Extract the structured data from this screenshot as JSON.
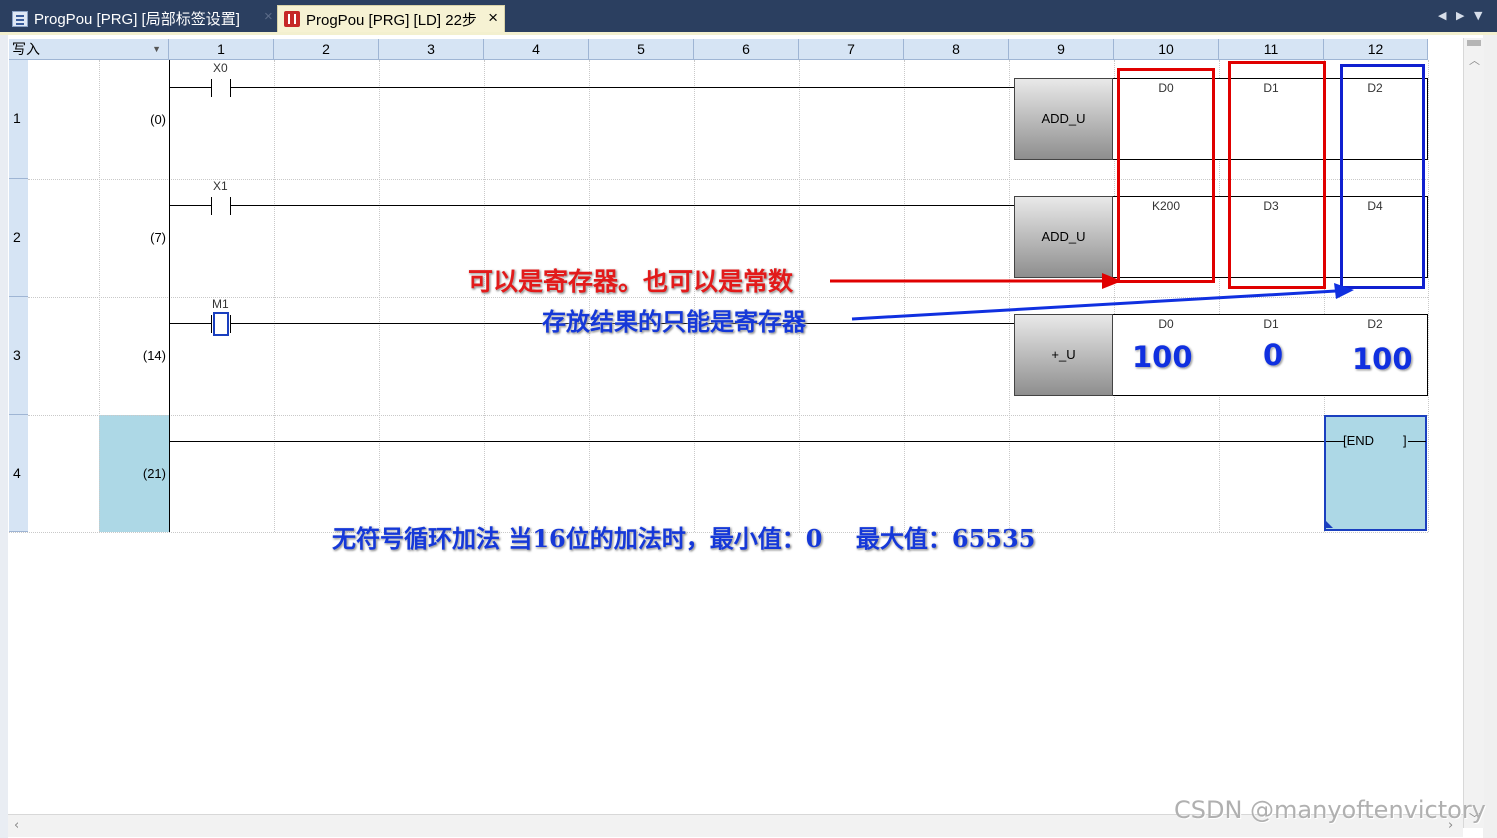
{
  "tabs": [
    {
      "label": "ProgPou [PRG] [局部标签设置]",
      "active": false
    },
    {
      "label": "ProgPou [PRG] [LD] 22步",
      "active": true
    }
  ],
  "tab_icons": {
    "inactive": "program-icon",
    "active": "ladder-icon",
    "close": "×"
  },
  "tab_nav": {
    "prev": "◀",
    "next": "▶",
    "menu": "▼"
  },
  "mode": "写入",
  "columns": [
    "1",
    "2",
    "3",
    "4",
    "5",
    "6",
    "7",
    "8",
    "9",
    "10",
    "11",
    "12"
  ],
  "rows": [
    {
      "num": "1",
      "step": "(0)",
      "contact": "X0",
      "instruction": "ADD_U",
      "operands": [
        "D0",
        "D1",
        "D2"
      ]
    },
    {
      "num": "2",
      "step": "(7)",
      "contact": "X1",
      "instruction": "ADD_U",
      "operands": [
        "K200",
        "D3",
        "D4"
      ]
    },
    {
      "num": "3",
      "step": "(14)",
      "contact": "M1",
      "instruction": "+_U",
      "operands": [
        "D0",
        "D1",
        "D2"
      ]
    },
    {
      "num": "4",
      "step": "(21)",
      "end": "END"
    }
  ],
  "values": [
    "100",
    "0",
    "100"
  ],
  "annotations": {
    "source": "可以是寄存器。也可以是常数",
    "dest": "存放结果的只能是寄存器",
    "note": "无符号循环加法 当16位的加法时，最小值：0    最大值：65535"
  },
  "colors": {
    "source_box": "#e00000",
    "dest_box": "#1020d0",
    "selection": "#add8e6",
    "header": "#d6e4f4"
  },
  "watermark": "CSDN @manyoftenvictory"
}
